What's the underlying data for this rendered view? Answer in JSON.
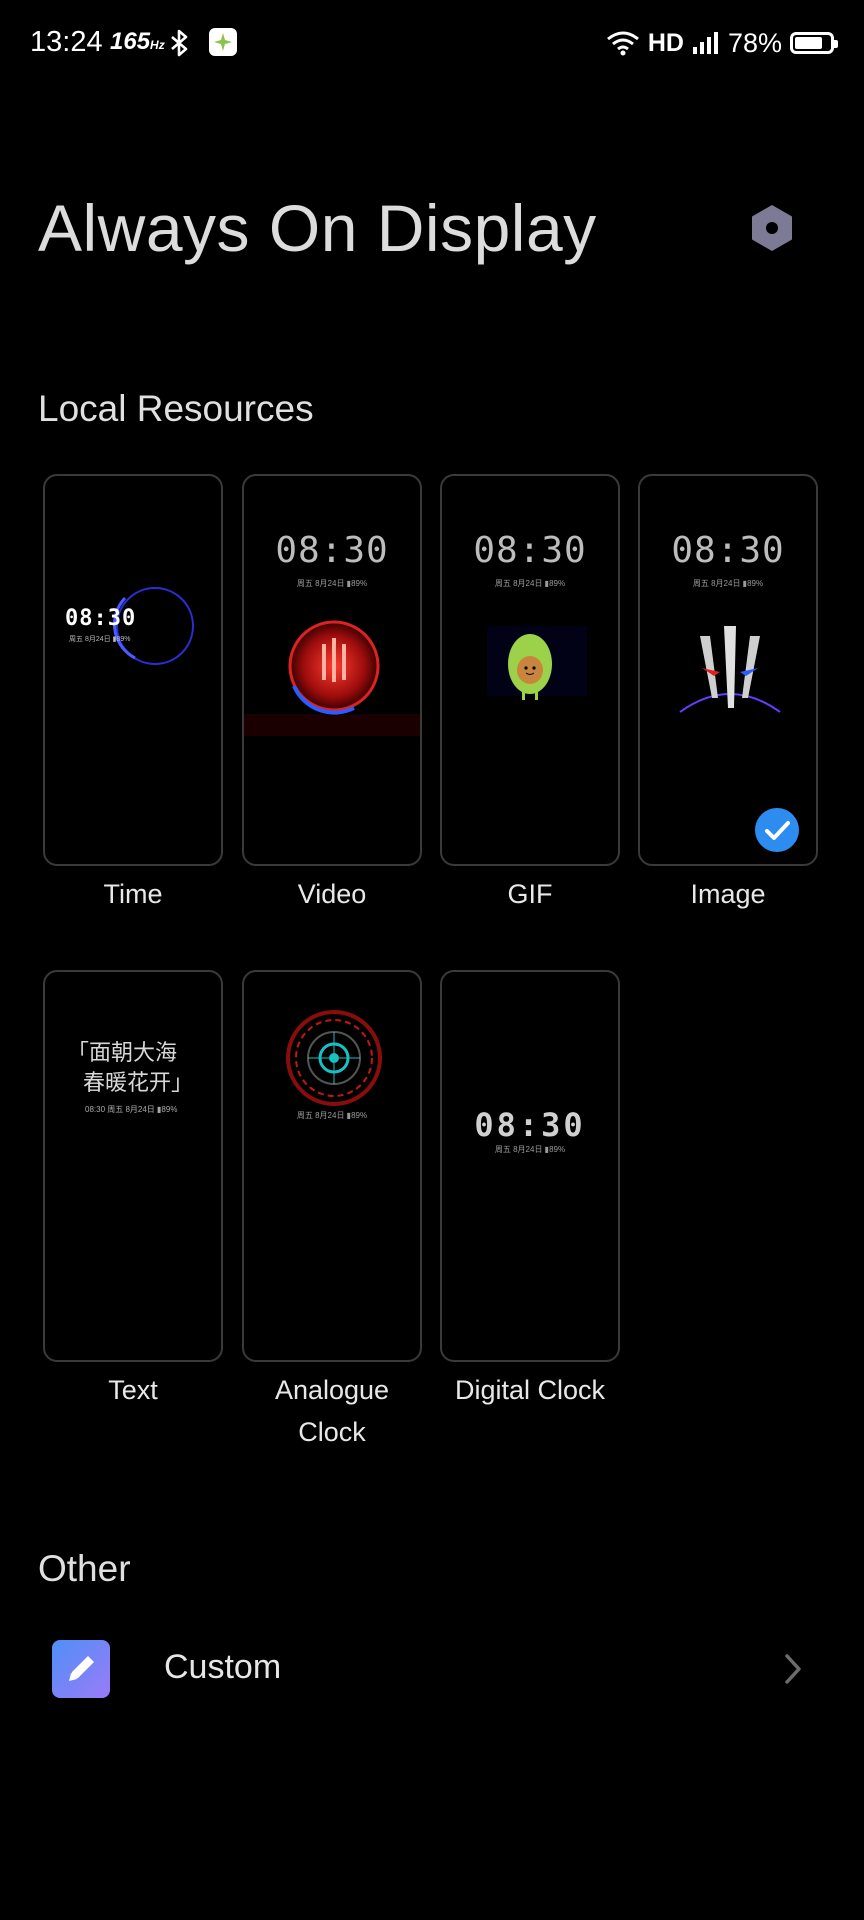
{
  "status_bar": {
    "time": "13:24",
    "refresh_rate": "165",
    "refresh_unit": "Hz",
    "network": "HD",
    "battery_percent": "78%",
    "battery_level": 0.78
  },
  "header": {
    "title": "Always On Display",
    "settings_icon": "hexagon-settings-icon"
  },
  "local_resources": {
    "title": "Local Resources",
    "items": [
      {
        "label": "Time",
        "preview_clock": "08:30",
        "preview_sub": "周五 8月24日 ▮89%",
        "selected": false
      },
      {
        "label": "Video",
        "preview_clock": "08:30",
        "preview_sub": "周五 8月24日 ▮89%",
        "selected": false
      },
      {
        "label": "GIF",
        "preview_clock": "08:30",
        "preview_sub": "周五 8月24日 ▮89%",
        "selected": false
      },
      {
        "label": "Image",
        "preview_clock": "08:30",
        "preview_sub": "周五 8月24日 ▮89%",
        "selected": true
      },
      {
        "label": "Text",
        "preview_text_line1": "「面朝大海",
        "preview_text_line2": "春暖花开」",
        "preview_sub": "08:30 周五 8月24日 ▮89%",
        "selected": false
      },
      {
        "label_line1": "Analogue",
        "label_line2": "Clock",
        "preview_sub": "周五 8月24日 ▮89%",
        "selected": false
      },
      {
        "label": "Digital Clock",
        "preview_clock": "08:30",
        "preview_sub": "周五 8月24日 ▮89%",
        "selected": false
      }
    ]
  },
  "other": {
    "title": "Other",
    "items": [
      {
        "label": "Custom",
        "icon": "pencil-edit-icon"
      }
    ]
  },
  "colors": {
    "accent": "#2d8cf0",
    "background": "#000000"
  }
}
